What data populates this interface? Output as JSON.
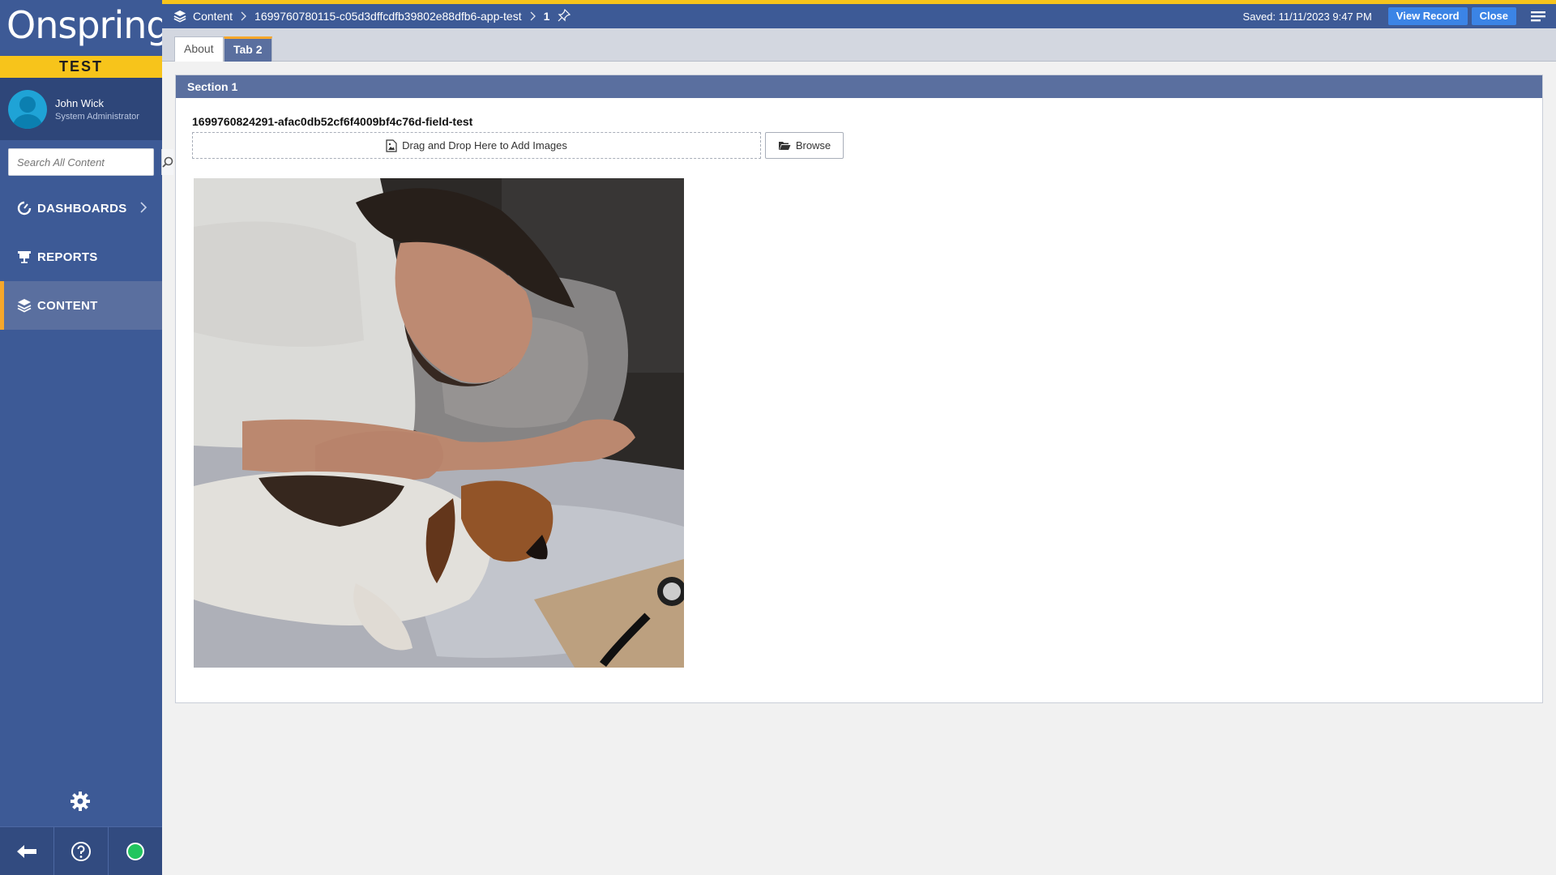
{
  "app": {
    "logo_text": "Onspring",
    "environment": "TEST"
  },
  "user": {
    "name": "John Wick",
    "role": "System Administrator"
  },
  "search": {
    "placeholder": "Search All Content"
  },
  "nav": {
    "items": [
      {
        "label": "DASHBOARDS",
        "icon": "dashboard-icon",
        "active": false,
        "has_chevron": true
      },
      {
        "label": "REPORTS",
        "icon": "reports-icon",
        "active": false,
        "has_chevron": false
      },
      {
        "label": "CONTENT",
        "icon": "layers-icon",
        "active": true,
        "has_chevron": false
      }
    ]
  },
  "breadcrumb": {
    "root": "Content",
    "app": "1699760780115-c05d3dffcdfb39802e88dfb6-app-test",
    "record": "1"
  },
  "header": {
    "saved_text": "Saved: 11/11/2023 9:47 PM",
    "view_record_label": "View Record",
    "close_label": "Close"
  },
  "tabs": [
    {
      "label": "About",
      "active": false
    },
    {
      "label": "Tab 2",
      "active": true
    }
  ],
  "section": {
    "title": "Section 1",
    "field_label": "1699760824291-afac0db52cf6f4009bf4c76d-field-test",
    "dropzone_text": "Drag and Drop Here to Add Images",
    "browse_label": "Browse",
    "image_alt": "Man sleeping next to a beagle dog on a bed"
  },
  "colors": {
    "sidebar": "#3d5a96",
    "accent_yellow": "#f7c41b",
    "accent_orange": "#f5a72b",
    "button_blue": "#3b84e6",
    "section_header": "#5a6f9f",
    "status_green": "#22c55e"
  }
}
